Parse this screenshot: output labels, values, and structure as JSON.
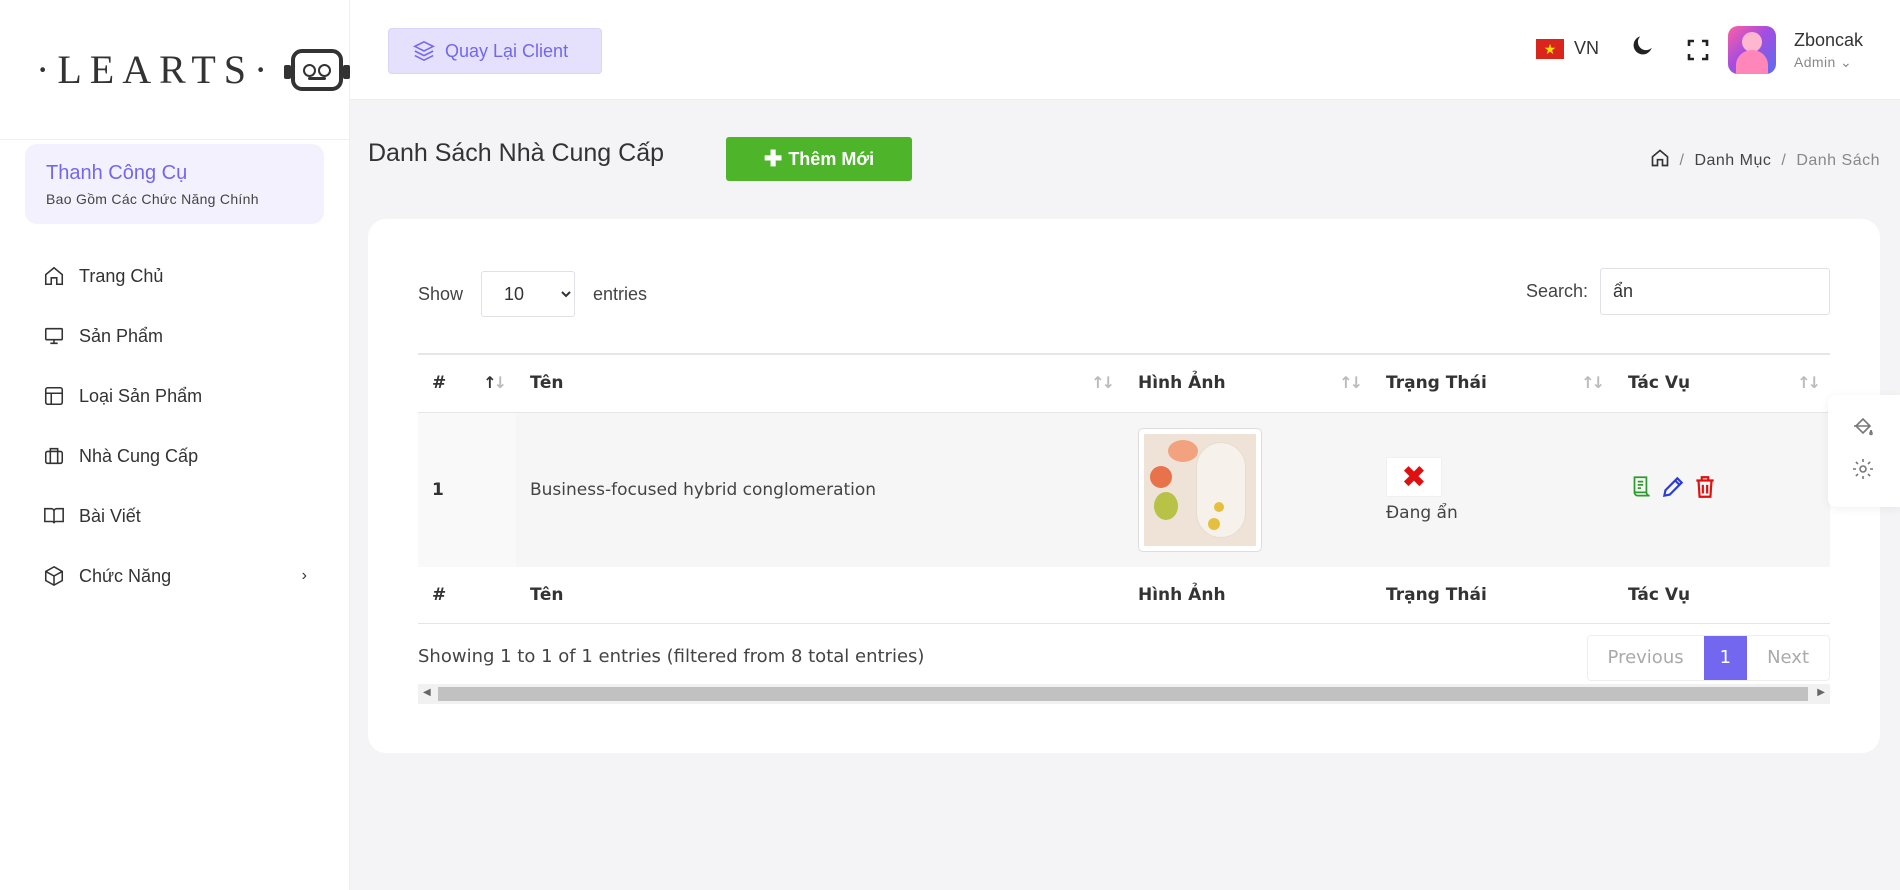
{
  "logo": {
    "text": "·LEARTS·"
  },
  "sidebar": {
    "toolbox_title": "Thanh Công Cụ",
    "toolbox_subtitle": "Bao Gồm Các Chức Năng Chính",
    "items": [
      {
        "label": "Trang Chủ",
        "icon": "home-icon"
      },
      {
        "label": "Sản Phẩm",
        "icon": "monitor-icon"
      },
      {
        "label": "Loại Sản Phẩm",
        "icon": "layout-icon"
      },
      {
        "label": "Nhà Cung Cấp",
        "icon": "briefcase-icon"
      },
      {
        "label": "Bài Viết",
        "icon": "book-icon"
      },
      {
        "label": "Chức Năng",
        "icon": "box-icon",
        "chevron": "›"
      }
    ]
  },
  "topbar": {
    "back_label": "Quay Lại Client",
    "lang": "VN",
    "user_name": "Zboncak",
    "user_role": "Admin"
  },
  "page": {
    "title": "Danh Sách Nhà Cung Cấp",
    "add_label": "Thêm Mới",
    "breadcrumb": [
      "Danh Mục",
      "Danh Sách"
    ]
  },
  "table": {
    "show_label": "Show",
    "entries_label": "entries",
    "page_length": "10",
    "search_label": "Search:",
    "search_value": "ẩn",
    "columns": [
      "#",
      "Tên",
      "Hình Ảnh",
      "Trạng Thái",
      "Tác Vụ"
    ],
    "rows": [
      {
        "id": "1",
        "name": "Business-focused hybrid conglomeration",
        "status": "Đang ẩn"
      }
    ],
    "info": "Showing 1 to 1 of 1 entries (filtered from 8 total entries)",
    "pager": {
      "prev": "Previous",
      "current": "1",
      "next": "Next"
    }
  },
  "colors": {
    "accent": "#7367f0",
    "add_button": "#4eb52a",
    "status_hidden": "#e01010",
    "edit": "#2b3bd6",
    "delete": "#e01010",
    "detail": "#2e9b2e"
  }
}
